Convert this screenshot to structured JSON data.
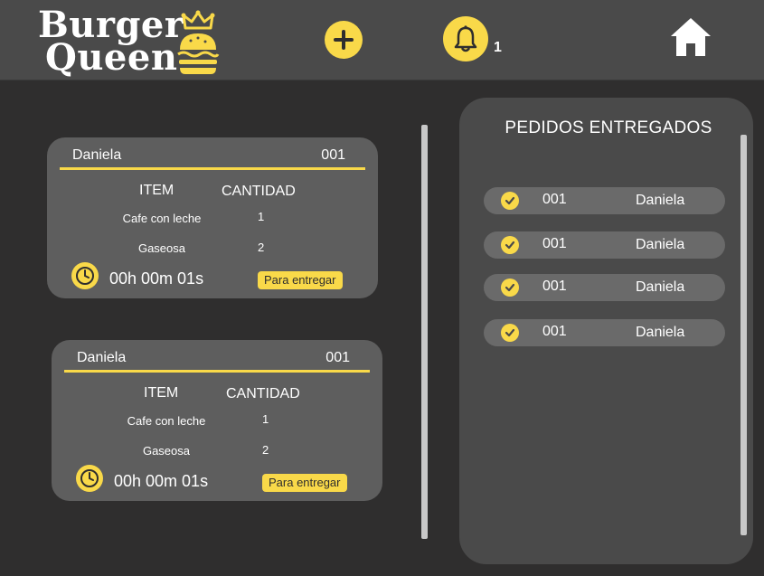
{
  "brand": {
    "word1": "Burger",
    "word2": "Queen"
  },
  "header": {
    "notification_count": "1"
  },
  "orders": [
    {
      "client": "Daniela",
      "number": "001",
      "col_item": "ITEM",
      "col_qty": "CANTIDAD",
      "items": [
        {
          "name": "Cafe con leche",
          "qty": "1"
        },
        {
          "name": "Gaseosa",
          "qty": "2"
        }
      ],
      "timer": "00h 00m 01s",
      "action": "Para entregar"
    },
    {
      "client": "Daniela",
      "number": "001",
      "col_item": "ITEM",
      "col_qty": "CANTIDAD",
      "items": [
        {
          "name": "Cafe con leche",
          "qty": "1"
        },
        {
          "name": "Gaseosa",
          "qty": "2"
        }
      ],
      "timer": "00h 00m 01s",
      "action": "Para entregar"
    }
  ],
  "delivered": {
    "title": "PEDIDOS ENTREGADOS",
    "rows": [
      {
        "number": "001",
        "client": "Daniela"
      },
      {
        "number": "001",
        "client": "Daniela"
      },
      {
        "number": "001",
        "client": "Daniela"
      },
      {
        "number": "001",
        "client": "Daniela"
      }
    ]
  },
  "colors": {
    "accent": "#f9d949",
    "header_bg": "#4a4a4a",
    "page_bg": "#2f2e2e",
    "card_bg": "#5e5e5e"
  },
  "icons": [
    "burger-crown-icon",
    "plus-icon",
    "bell-icon",
    "home-icon",
    "clock-icon",
    "check-icon"
  ]
}
